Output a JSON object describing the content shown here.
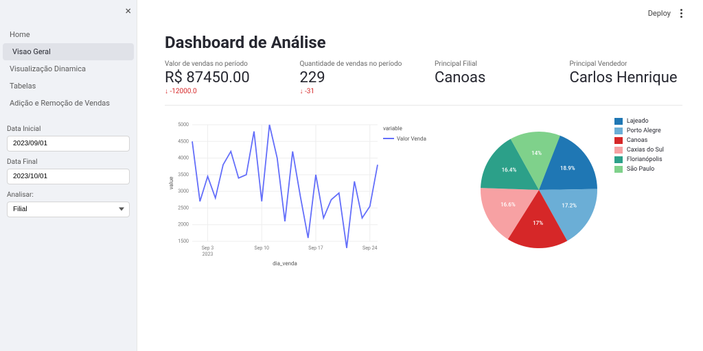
{
  "topbar": {
    "deploy": "Deploy"
  },
  "sidebar": {
    "items": [
      {
        "label": "Home"
      },
      {
        "label": "Visao Geral"
      },
      {
        "label": "Visualização Dinamica"
      },
      {
        "label": "Tabelas"
      },
      {
        "label": "Adição e Remoção de Vendas"
      }
    ],
    "data_inicial_label": "Data Inicial",
    "data_inicial_value": "2023/09/01",
    "data_final_label": "Data Final",
    "data_final_value": "2023/10/01",
    "analisar_label": "Analisar:",
    "analisar_value": "Filial"
  },
  "page": {
    "title": "Dashboard de Análise",
    "metrics": [
      {
        "label": "Valor de vendas no período",
        "value": "R$ 87450.00",
        "delta": "-12000.0"
      },
      {
        "label": "Quantidade de vendas no período",
        "value": "229",
        "delta": "-31"
      },
      {
        "label": "Principal Filial",
        "value": "Canoas",
        "delta": ""
      },
      {
        "label": "Principal Vendedor",
        "value": "Carlos Henrique",
        "delta": ""
      }
    ]
  },
  "chart_data": [
    {
      "type": "line",
      "xlabel": "dia_venda",
      "ylabel": "value",
      "legend_title": "variable",
      "series_name": "Valor Venda",
      "ylim": [
        1500,
        5000
      ],
      "x_ticks": [
        "Sep 3",
        "Sep 10",
        "Sep 17",
        "Sep 24"
      ],
      "x_tick_sub": "2023",
      "y_ticks": [
        1500,
        2000,
        2500,
        3000,
        3500,
        4000,
        4500,
        5000
      ],
      "x": [
        1,
        2,
        3,
        4,
        5,
        6,
        7,
        8,
        9,
        10,
        11,
        12,
        13,
        14,
        15,
        16,
        17,
        18,
        19,
        20,
        21,
        22,
        23,
        24,
        25
      ],
      "y": [
        4500,
        2700,
        3450,
        2800,
        3800,
        4200,
        3400,
        3500,
        4800,
        2700,
        5000,
        4000,
        2100,
        4200,
        2850,
        1600,
        3500,
        2200,
        2750,
        2950,
        1300,
        3300,
        2200,
        2550,
        3800
      ]
    },
    {
      "type": "pie",
      "slices": [
        {
          "label": "Lajeado",
          "pct": 18.9,
          "color": "#1f77b4"
        },
        {
          "label": "Porto Alegre",
          "pct": 17.2,
          "color": "#6baed6"
        },
        {
          "label": "Canoas",
          "pct": 17.0,
          "color": "#d62728"
        },
        {
          "label": "Caxias do Sul",
          "pct": 16.6,
          "color": "#f7a1a3"
        },
        {
          "label": "Florianópolis",
          "pct": 16.4,
          "color": "#2ca089"
        },
        {
          "label": "São Paulo",
          "pct": 14.0,
          "color": "#7fd18b"
        }
      ]
    }
  ]
}
